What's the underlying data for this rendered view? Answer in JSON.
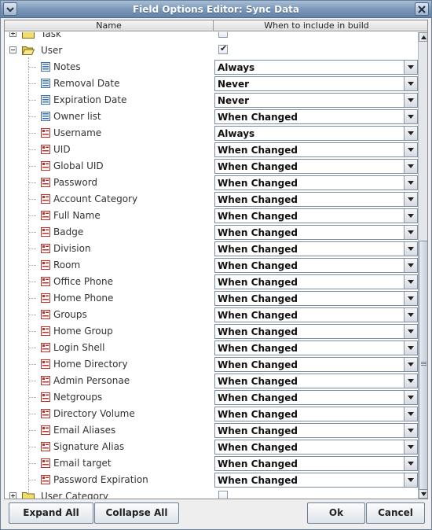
{
  "window": {
    "title": "Field Options Editor: Sync Data"
  },
  "header": {
    "name_col": "Name",
    "when_col": "When to include in build"
  },
  "tree": {
    "top_partial": {
      "label": "Task",
      "expanded": false,
      "checked": false
    },
    "user": {
      "label": "User",
      "expanded": true,
      "checked": true,
      "check_mark": "✔"
    },
    "fields": [
      {
        "label": "Notes",
        "icon": "blue-list-field-icon",
        "value": "Always"
      },
      {
        "label": "Removal Date",
        "icon": "blue-list-field-icon",
        "value": "Never"
      },
      {
        "label": "Expiration Date",
        "icon": "blue-list-field-icon",
        "value": "Never"
      },
      {
        "label": "Owner list",
        "icon": "blue-list-field-icon",
        "value": "When Changed"
      },
      {
        "label": "Username",
        "icon": "red-field-icon",
        "value": "Always"
      },
      {
        "label": "UID",
        "icon": "red-field-icon",
        "value": "When Changed"
      },
      {
        "label": "Global UID",
        "icon": "red-field-icon",
        "value": "When Changed"
      },
      {
        "label": "Password",
        "icon": "red-field-icon",
        "value": "When Changed"
      },
      {
        "label": "Account Category",
        "icon": "red-field-icon",
        "value": "When Changed"
      },
      {
        "label": "Full Name",
        "icon": "red-field-icon",
        "value": "When Changed"
      },
      {
        "label": "Badge",
        "icon": "red-field-icon",
        "value": "When Changed"
      },
      {
        "label": "Division",
        "icon": "red-field-icon",
        "value": "When Changed"
      },
      {
        "label": "Room",
        "icon": "red-field-icon",
        "value": "When Changed"
      },
      {
        "label": "Office Phone",
        "icon": "red-field-icon",
        "value": "When Changed"
      },
      {
        "label": "Home Phone",
        "icon": "red-field-icon",
        "value": "When Changed"
      },
      {
        "label": "Groups",
        "icon": "red-field-icon",
        "value": "When Changed"
      },
      {
        "label": "Home Group",
        "icon": "red-field-icon",
        "value": "When Changed"
      },
      {
        "label": "Login Shell",
        "icon": "red-field-icon",
        "value": "When Changed"
      },
      {
        "label": "Home Directory",
        "icon": "red-field-icon",
        "value": "When Changed"
      },
      {
        "label": "Admin Personae",
        "icon": "red-field-icon",
        "value": "When Changed"
      },
      {
        "label": "Netgroups",
        "icon": "red-field-icon",
        "value": "When Changed"
      },
      {
        "label": "Directory Volume",
        "icon": "red-field-icon",
        "value": "When Changed"
      },
      {
        "label": "Email Aliases",
        "icon": "red-field-icon",
        "value": "When Changed"
      },
      {
        "label": "Signature Alias",
        "icon": "red-field-icon",
        "value": "When Changed"
      },
      {
        "label": "Email target",
        "icon": "red-field-icon",
        "value": "When Changed"
      },
      {
        "label": "Password Expiration",
        "icon": "red-field-icon",
        "value": "When Changed"
      }
    ],
    "bottom": {
      "label": "User Category",
      "expanded": false,
      "checked": false
    }
  },
  "buttons": {
    "expand_all": "Expand All",
    "collapse_all": "Collapse All",
    "ok": "Ok",
    "cancel": "Cancel"
  },
  "colors": {
    "title_bar": "#7a97b8",
    "blue_icon": "#3b6fb0",
    "red_icon": "#c0302a",
    "folder": "#f2dc6a"
  }
}
